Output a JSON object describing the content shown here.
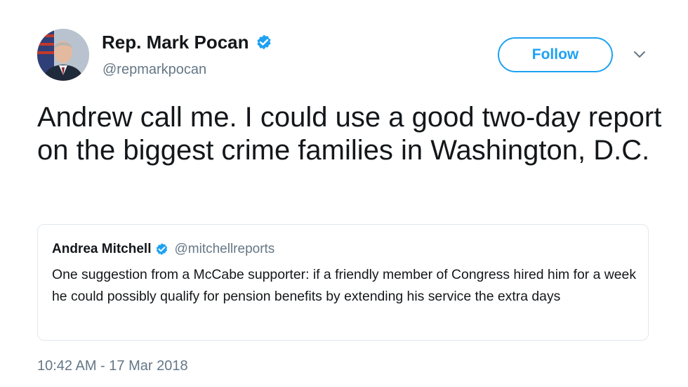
{
  "tweet": {
    "author": {
      "display_name": "Rep. Mark Pocan",
      "handle": "@repmarkpocan",
      "verified": true
    },
    "follow_label": "Follow",
    "text": "Andrew call me. I could use a good two-day report on the biggest crime families in Washington, D.C.",
    "timestamp": "10:42 AM - 17 Mar 2018"
  },
  "quoted_tweet": {
    "display_name": "Andrea Mitchell",
    "handle": "@mitchellreports",
    "verified": true,
    "text": "One suggestion from a McCabe supporter: if a friendly member of Congress hired him for a week he could possibly qualify for pension benefits by extending his service the extra days"
  },
  "colors": {
    "accent": "#1da1f2",
    "text_primary": "#14171a",
    "text_secondary": "#657786",
    "border": "#e1e8ed"
  },
  "icons": {
    "verified": "verified-badge-icon",
    "menu": "chevron-down-icon"
  }
}
